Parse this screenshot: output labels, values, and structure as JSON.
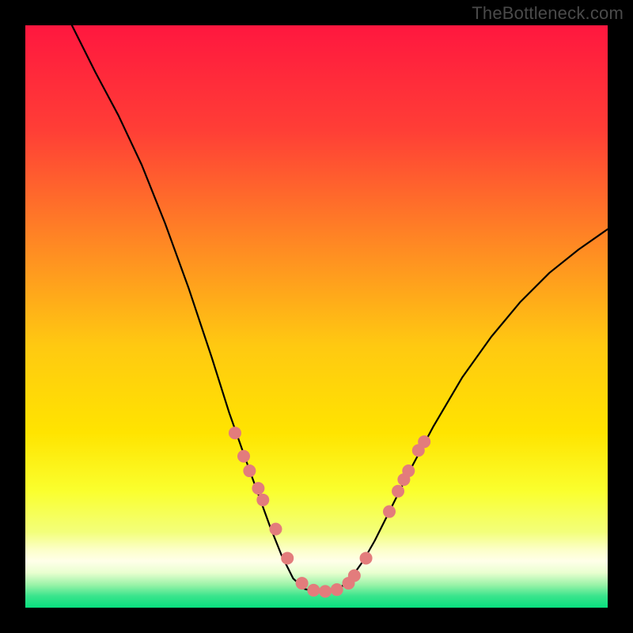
{
  "watermark": "TheBottleneck.com",
  "chart_data": {
    "type": "scatter",
    "title": "",
    "xlabel": "",
    "ylabel": "",
    "xlim": [
      0,
      100
    ],
    "ylim": [
      0,
      100
    ],
    "background_gradient": {
      "top": "#ff173f",
      "middle_high": "#ff6a2a",
      "middle": "#ffd400",
      "middle_low": "#f8ff48",
      "band": "#fffdd9",
      "bottom": "#08e07f"
    },
    "curve": {
      "description": "left arm descends from near top-left into a flat bottom around x≈46..56 then rises to mid-right",
      "points": [
        {
          "x": 8.0,
          "y": 100.0
        },
        {
          "x": 12.0,
          "y": 92.0
        },
        {
          "x": 16.0,
          "y": 84.5
        },
        {
          "x": 20.0,
          "y": 76.0
        },
        {
          "x": 24.0,
          "y": 66.0
        },
        {
          "x": 28.0,
          "y": 55.0
        },
        {
          "x": 32.0,
          "y": 43.0
        },
        {
          "x": 35.0,
          "y": 33.5
        },
        {
          "x": 38.0,
          "y": 25.0
        },
        {
          "x": 40.0,
          "y": 19.5
        },
        {
          "x": 42.0,
          "y": 14.0
        },
        {
          "x": 44.0,
          "y": 9.0
        },
        {
          "x": 46.0,
          "y": 5.0
        },
        {
          "x": 48.0,
          "y": 3.2
        },
        {
          "x": 50.0,
          "y": 2.7
        },
        {
          "x": 52.0,
          "y": 2.7
        },
        {
          "x": 54.0,
          "y": 3.3
        },
        {
          "x": 56.0,
          "y": 5.2
        },
        {
          "x": 58.0,
          "y": 8.0
        },
        {
          "x": 60.0,
          "y": 11.5
        },
        {
          "x": 63.0,
          "y": 17.5
        },
        {
          "x": 66.0,
          "y": 23.5
        },
        {
          "x": 70.0,
          "y": 31.0
        },
        {
          "x": 75.0,
          "y": 39.5
        },
        {
          "x": 80.0,
          "y": 46.5
        },
        {
          "x": 85.0,
          "y": 52.5
        },
        {
          "x": 90.0,
          "y": 57.5
        },
        {
          "x": 95.0,
          "y": 61.5
        },
        {
          "x": 100.0,
          "y": 65.0
        }
      ]
    },
    "markers": {
      "description": "pink circular markers clustered on both arms near the bottom and along the flat bottom",
      "color": "#e37c7c",
      "radius_px": 8,
      "points": [
        {
          "x": 36.0,
          "y": 30.0
        },
        {
          "x": 37.5,
          "y": 26.0
        },
        {
          "x": 38.5,
          "y": 23.5
        },
        {
          "x": 40.0,
          "y": 20.5
        },
        {
          "x": 40.8,
          "y": 18.5
        },
        {
          "x": 43.0,
          "y": 13.5
        },
        {
          "x": 45.0,
          "y": 8.5
        },
        {
          "x": 47.5,
          "y": 4.2
        },
        {
          "x": 49.5,
          "y": 3.0
        },
        {
          "x": 51.5,
          "y": 2.8
        },
        {
          "x": 53.5,
          "y": 3.1
        },
        {
          "x": 55.5,
          "y": 4.2
        },
        {
          "x": 56.5,
          "y": 5.5
        },
        {
          "x": 58.5,
          "y": 8.5
        },
        {
          "x": 62.5,
          "y": 16.5
        },
        {
          "x": 64.0,
          "y": 20.0
        },
        {
          "x": 65.0,
          "y": 22.0
        },
        {
          "x": 65.8,
          "y": 23.5
        },
        {
          "x": 67.5,
          "y": 27.0
        },
        {
          "x": 68.5,
          "y": 28.5
        }
      ]
    }
  }
}
